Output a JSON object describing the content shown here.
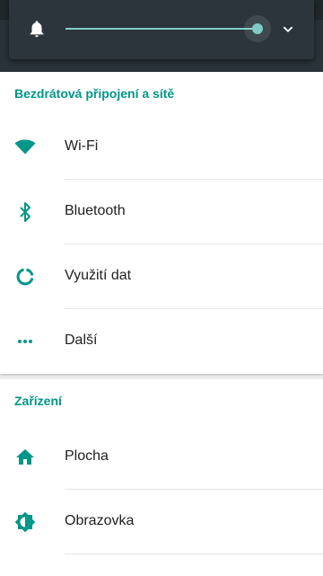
{
  "colors": {
    "accent": "#009688",
    "slider": "#80cbc4",
    "panel": "#2b353b"
  },
  "volume": {
    "icon": "bell-icon",
    "level": 0.97,
    "expand_icon": "chevron-down-icon"
  },
  "sections": [
    {
      "header": "Bezdrátová připojení a sítě",
      "items": [
        {
          "label": "Wi-Fi",
          "icon": "wifi-icon"
        },
        {
          "label": "Bluetooth",
          "icon": "bluetooth-icon"
        },
        {
          "label": "Využití dat",
          "icon": "data-usage-icon"
        },
        {
          "label": "Další",
          "icon": "more-icon"
        }
      ]
    },
    {
      "header": "Zařízení",
      "items": [
        {
          "label": "Plocha",
          "icon": "home-icon"
        },
        {
          "label": "Obrazovka",
          "icon": "brightness-icon"
        }
      ]
    }
  ]
}
